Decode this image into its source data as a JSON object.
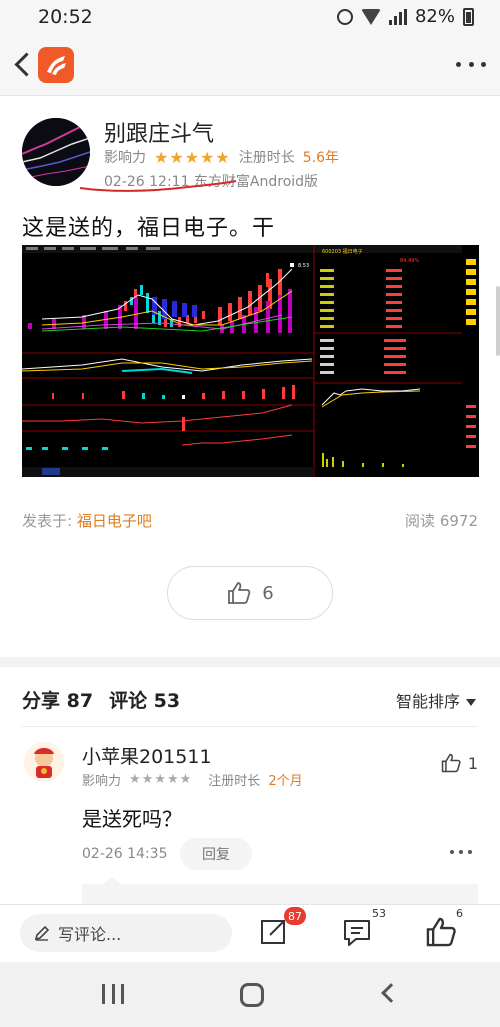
{
  "status_bar": {
    "time": "20:52",
    "battery": "82%"
  },
  "post": {
    "author": "别跟庄斗气",
    "influence_label": "影响力",
    "stars": "★★★★★",
    "reg_label": "注册时长",
    "reg_value": "5.6年",
    "date_source": "02-26 12:11 东方财富Android版",
    "text": "这是送的，福日电子。干",
    "posted_in_label": "发表于:",
    "posted_in_bar": "福日电子吧",
    "reads": "阅读 6972",
    "like_count": "6"
  },
  "stock_image": {
    "code_name": "600203 福日电子",
    "high_label": "8.53",
    "chg": "84.49%"
  },
  "stats": {
    "share": "分享 87",
    "comment": "评论 53",
    "sort": "智能排序"
  },
  "comment": {
    "author": "小苹果201511",
    "influence_label": "影响力",
    "stars": "★★★★★",
    "reg_label": "注册时长",
    "reg_value": "2个月",
    "like_count": "1",
    "text": "是送死吗？",
    "time": "02-26 14:35",
    "reply_label": "回复"
  },
  "toolbar": {
    "write_placeholder": "写评论...",
    "share_badge": "87",
    "comment_badge": "53",
    "like_badge": "6"
  },
  "colors": {
    "accent": "#e07b22",
    "star": "#f0a52b",
    "brand": "#f05a28",
    "badge": "#e63b2e"
  }
}
